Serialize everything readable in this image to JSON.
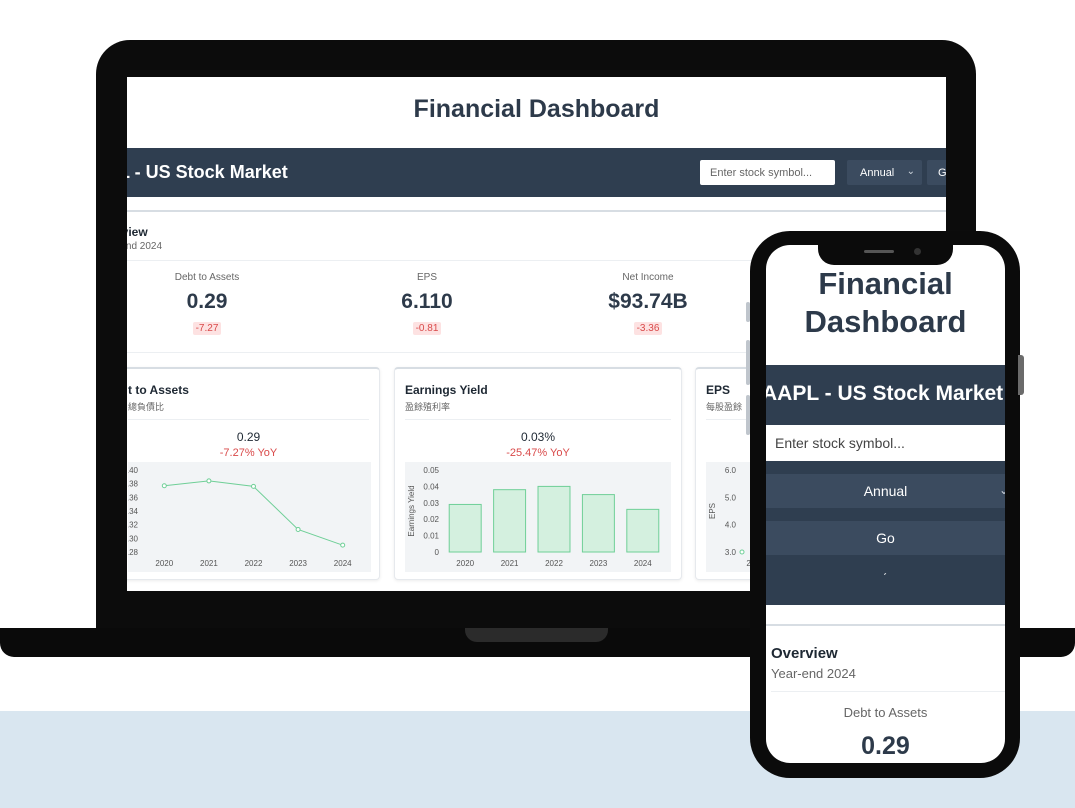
{
  "dashboard": {
    "title": "Financial Dashboard",
    "market_title": "PL - US Stock Market",
    "symbol_placeholder": "Enter stock symbol...",
    "period": "Annual",
    "go_label": "G",
    "overview_title": "rview",
    "overview_subtitle": "-end 2024",
    "kpis": [
      {
        "label": "Debt to Assets",
        "value": "0.29",
        "change": "-7.27"
      },
      {
        "label": "EPS",
        "value": "6.110",
        "change": "-0.81"
      },
      {
        "label": "Net Income",
        "value": "$93.74B",
        "change": "-3.36"
      }
    ],
    "cards": [
      {
        "title": "t to Assets",
        "subtitle": "總負債比",
        "value": "0.29",
        "change": "-7.27% YoY"
      },
      {
        "title": "Earnings Yield",
        "subtitle": "盈餘殖利率",
        "value": "0.03%",
        "change": "-25.47% YoY"
      },
      {
        "title": "EPS",
        "subtitle": "每股盈餘"
      }
    ]
  },
  "phone": {
    "title": "Financial Dashboard",
    "market_title": "AAPL - US Stock Market",
    "symbol_placeholder": "Enter stock symbol...",
    "period": "Annual",
    "go_label": "Go",
    "loading_mark": "ˊ",
    "overview_title": "Overview",
    "overview_subtitle": "Year-end 2024",
    "kpi_label": "Debt to Assets",
    "kpi_value": "0.29"
  },
  "icons": {
    "select_chevron": "chevron-down-icon"
  },
  "chart_data": [
    {
      "type": "line",
      "x": [
        "2020",
        "2021",
        "2022",
        "2023",
        "2024"
      ],
      "values": [
        0.377,
        0.384,
        0.376,
        0.313,
        0.29
      ],
      "ylim": [
        0.28,
        0.4
      ],
      "yticks": [
        ".40",
        ".38",
        ".36",
        ".34",
        ".32",
        ".30",
        ".28"
      ],
      "color": "#6fcf97"
    },
    {
      "type": "bar",
      "categories": [
        "2020",
        "2021",
        "2022",
        "2023",
        "2024"
      ],
      "values": [
        0.029,
        0.038,
        0.04,
        0.035,
        0.026
      ],
      "ylim": [
        0,
        0.05
      ],
      "yticks": [
        "0.05",
        "0.04",
        "0.03",
        "0.02",
        "0.01",
        "0"
      ],
      "ylabel": "Earnings Yield",
      "color": "#6fcf97"
    },
    {
      "type": "line",
      "x": [
        "202"
      ],
      "values": [
        3.0
      ],
      "ylim": [
        3.0,
        6.0
      ],
      "yticks": [
        "6.0",
        "5.0",
        "4.0",
        "3.0"
      ],
      "ylabel": "EPS",
      "color": "#6fcf97"
    }
  ]
}
